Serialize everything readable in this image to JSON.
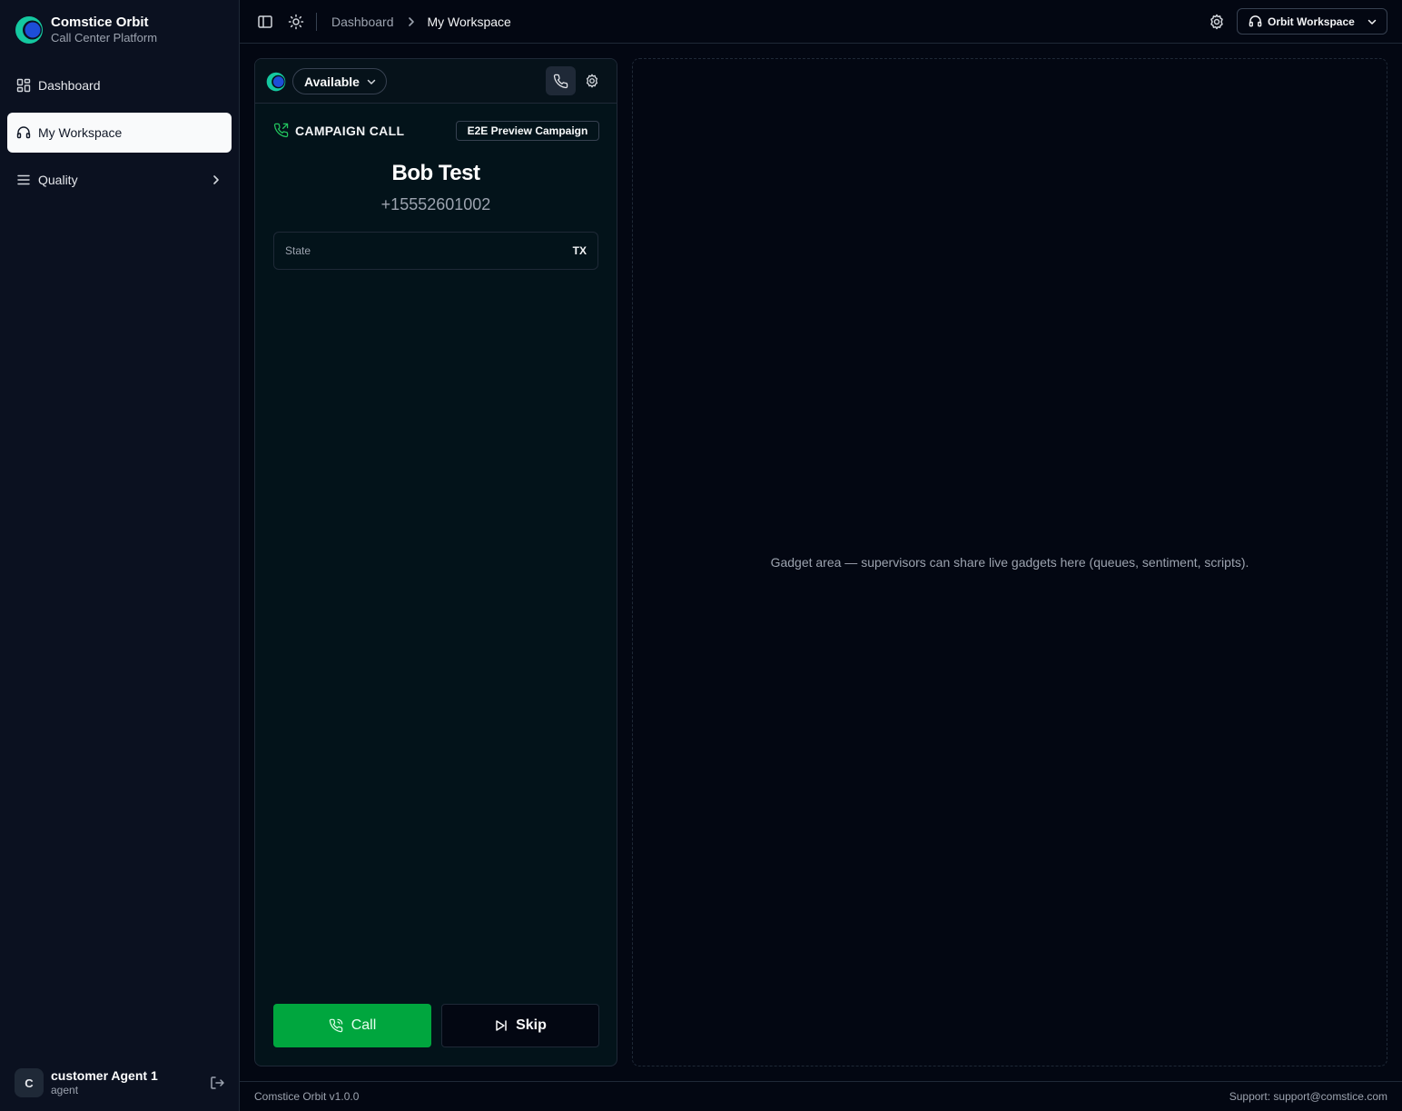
{
  "brand": {
    "name": "Comstice Orbit",
    "subtitle": "Call Center Platform"
  },
  "sidebar": {
    "items": [
      {
        "label": "Dashboard",
        "icon": "grid-icon",
        "active": false
      },
      {
        "label": "My Workspace",
        "icon": "headset-icon",
        "active": true
      },
      {
        "label": "Quality",
        "icon": "menu-icon",
        "active": false,
        "expandable": true
      }
    ]
  },
  "user": {
    "initial": "C",
    "name": "customer Agent 1",
    "role": "agent"
  },
  "topbar": {
    "breadcrumb": {
      "parent": "Dashboard",
      "current": "My Workspace"
    },
    "workspace_select": "Orbit Workspace"
  },
  "agent_panel": {
    "status": "Available",
    "call_type": "CAMPAIGN CALL",
    "campaign": "E2E Preview Campaign",
    "contact": {
      "name": "Bob Test",
      "phone": "+15552601002"
    },
    "fields": [
      {
        "label": "State",
        "value": "TX"
      }
    ],
    "call_button": "Call",
    "skip_button": "Skip"
  },
  "gadget_area": {
    "text": "Gadget area — supervisors can share live gadgets here (queues, sentiment, scripts)."
  },
  "footer": {
    "version": "Comstice Orbit v1.0.0",
    "support": "Support: support@comstice.com"
  },
  "colors": {
    "accent_green": "#00a63e",
    "background": "#030712",
    "sidebar_bg": "#0b1120",
    "logo_teal": "#14c8a0",
    "logo_blue": "#1d4ed8"
  }
}
